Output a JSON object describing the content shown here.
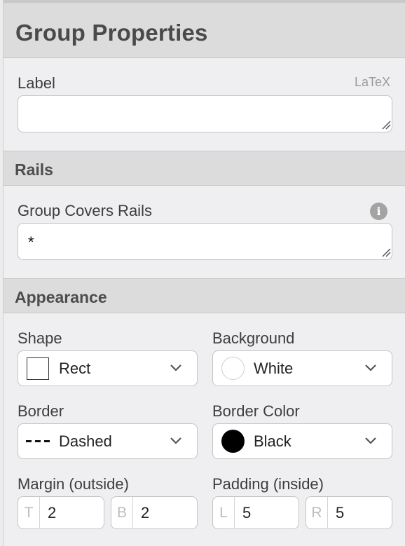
{
  "panel": {
    "title": "Group Properties",
    "label_field": {
      "label": "Label",
      "hint": "LaTeX",
      "value": ""
    },
    "rails_section": {
      "title": "Rails",
      "covers_label": "Group Covers Rails",
      "covers_value": "*",
      "info_icon": "info-icon"
    },
    "appearance": {
      "title": "Appearance",
      "shape": {
        "label": "Shape",
        "value": "Rect",
        "icon": "square-swatch-icon"
      },
      "background": {
        "label": "Background",
        "value": "White",
        "swatch_color": "#ffffff"
      },
      "border": {
        "label": "Border",
        "value": "Dashed",
        "icon": "dashed-line-icon"
      },
      "border_color": {
        "label": "Border Color",
        "value": "Black",
        "swatch_color": "#000000"
      },
      "margin": {
        "label": "Margin (outside)",
        "top_prefix": "T",
        "top": "2",
        "bottom_prefix": "B",
        "bottom": "2"
      },
      "padding": {
        "label": "Padding (inside)",
        "left_prefix": "L",
        "left": "5",
        "right_prefix": "R",
        "right": "5"
      }
    }
  }
}
